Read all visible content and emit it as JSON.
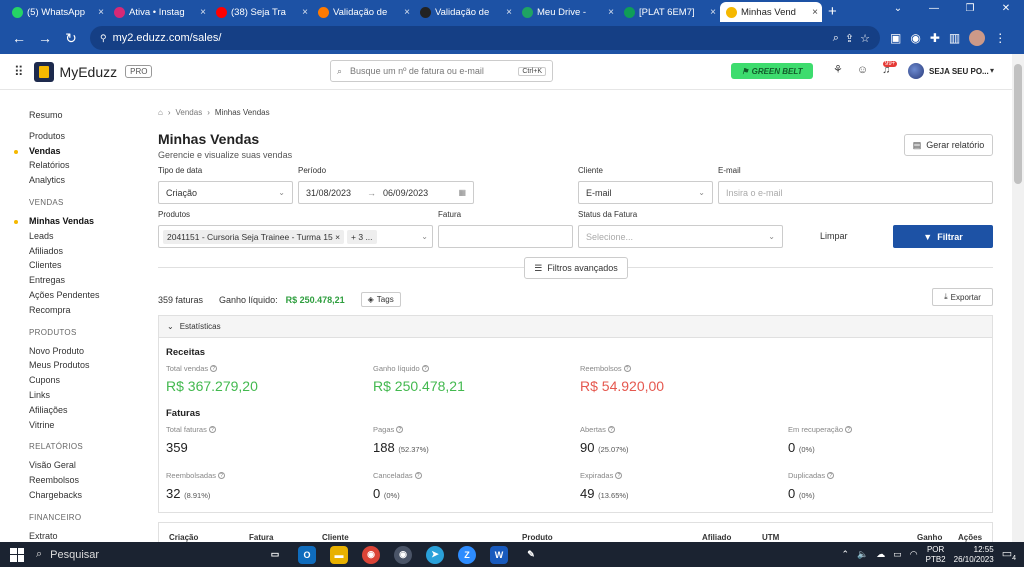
{
  "browser": {
    "tabs": [
      {
        "title": "(5) WhatsApp",
        "icon_color": "#25d366",
        "icon": "whatsapp-icon"
      },
      {
        "title": "Ativa • Instag",
        "icon_color": "#d62976",
        "icon": "instagram-icon"
      },
      {
        "title": "(38) Seja Tra",
        "icon_color": "#ff0000",
        "icon": "youtube-icon"
      },
      {
        "title": "Validação de",
        "icon_color": "#ff7a00",
        "icon": "hotmart-icon"
      },
      {
        "title": "Validação de",
        "icon_color": "#222222",
        "icon": "page-icon"
      },
      {
        "title": "Meu Drive - ",
        "icon_color": "#1fa463",
        "icon": "drive-icon"
      },
      {
        "title": "[PLAT 6EM7]",
        "icon_color": "#0f9d58",
        "icon": "sheets-icon"
      },
      {
        "title": "Minhas Vend",
        "icon_color": "#f5b800",
        "icon": "eduzz-icon",
        "active": true
      }
    ],
    "url": "my2.eduzz.com/sales/"
  },
  "header": {
    "brand": "MyEduzz",
    "badge": "PRO",
    "search_placeholder": "Busque um nº de fatura ou e-mail",
    "search_shortcut": "Ctrl+K",
    "belt": "GREEN BELT",
    "notif_count": "99+",
    "user_name": "SEJA SEU PO..."
  },
  "sidebar": {
    "top": [
      {
        "label": "Resumo"
      },
      {
        "label": "Produtos"
      },
      {
        "label": "Vendas",
        "active": true
      },
      {
        "label": "Relatórios"
      },
      {
        "label": "Analytics"
      }
    ],
    "sections": [
      {
        "title": "VENDAS",
        "items": [
          "Minhas Vendas",
          "Leads",
          "Afiliados",
          "Clientes",
          "Entregas",
          "Ações Pendentes",
          "Recompra"
        ]
      },
      {
        "title": "PRODUTOS",
        "items": [
          "Novo Produto",
          "Meus Produtos",
          "Cupons",
          "Links",
          "Afiliações",
          "Vitrine"
        ]
      },
      {
        "title": "RELATÓRIOS",
        "items": [
          "Visão Geral",
          "Reembolsos",
          "Chargebacks"
        ]
      },
      {
        "title": "FINANCEIRO",
        "items": [
          "Extrato"
        ]
      }
    ]
  },
  "page": {
    "breadcrumb": [
      "Vendas",
      "Minhas Vendas"
    ],
    "title": "Minhas Vendas",
    "subtitle": "Gerencie e visualize suas vendas",
    "report_button": "Gerar relatório"
  },
  "filters": {
    "tipo_label": "Tipo de data",
    "tipo_value": "Criação",
    "periodo_label": "Período",
    "periodo_from": "31/08/2023",
    "periodo_to": "06/09/2023",
    "cliente_label": "Cliente",
    "cliente_value": "E-mail",
    "email_label": "E-mail",
    "email_placeholder": "Insira o e-mail",
    "produtos_label": "Produtos",
    "produtos_chip": "2041151 - Cursoria Seja Trainee - Turma 15",
    "produtos_more": "+ 3 ...",
    "fatura_label": "Fatura",
    "status_label": "Status da Fatura",
    "status_placeholder": "Selecione...",
    "clear": "Limpar",
    "submit": "Filtrar",
    "advanced": "Filtros avançados"
  },
  "summary": {
    "count": "359 faturas",
    "net_label": "Ganho líquido:",
    "net_value": "R$ 250.478,21",
    "tags": "Tags",
    "export": "Exportar"
  },
  "stats": {
    "header": "Estatísticas",
    "receitas_title": "Receitas",
    "receitas": [
      {
        "label": "Total vendas",
        "value": "R$ 367.279,20",
        "color": "#43b94f"
      },
      {
        "label": "Ganho líquido",
        "value": "R$ 250.478,21",
        "color": "#43b94f"
      },
      {
        "label": "Reembolsos",
        "value": "R$ 54.920,00",
        "color": "#e5584f"
      }
    ],
    "faturas_title": "Faturas",
    "faturas": [
      {
        "label": "Total faturas",
        "value": "359",
        "pct": ""
      },
      {
        "label": "Pagas",
        "value": "188",
        "pct": "(52.37%)"
      },
      {
        "label": "Abertas",
        "value": "90",
        "pct": "(25.07%)"
      },
      {
        "label": "Em recuperação",
        "value": "0",
        "pct": "(0%)"
      },
      {
        "label": "Reembolsadas",
        "value": "32",
        "pct": "(8.91%)"
      },
      {
        "label": "Canceladas",
        "value": "0",
        "pct": "(0%)"
      },
      {
        "label": "Expiradas",
        "value": "49",
        "pct": "(13.65%)"
      },
      {
        "label": "Duplicadas",
        "value": "0",
        "pct": "(0%)"
      }
    ]
  },
  "table": {
    "columns": [
      "Criação",
      "Fatura",
      "Cliente",
      "Produto",
      "Afiliado",
      "UTM",
      "Ganho",
      "Ações"
    ]
  },
  "taskbar": {
    "search": "Pesquisar",
    "lang_1": "POR",
    "lang_2": "PTB2",
    "time": "12:55",
    "date": "26/10/2023",
    "notif": "4"
  }
}
